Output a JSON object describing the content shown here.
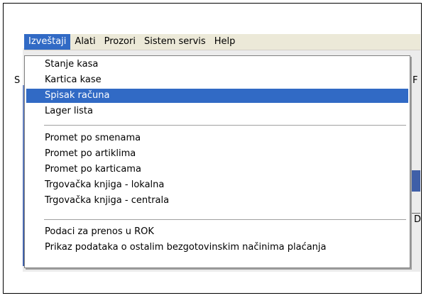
{
  "menubar": {
    "items": [
      {
        "label": "Izveštaji"
      },
      {
        "label": "Alati"
      },
      {
        "label": "Prozori"
      },
      {
        "label": "Sistem servis"
      },
      {
        "label": "Help"
      }
    ]
  },
  "dropdown": {
    "group1": [
      {
        "label": "Stanje kasa"
      },
      {
        "label": "Kartica kase"
      },
      {
        "label": "Spisak računa"
      },
      {
        "label": "Lager lista"
      }
    ],
    "group2": [
      {
        "label": "Promet po smenama"
      },
      {
        "label": "Promet po artiklima"
      },
      {
        "label": "Promet po karticama"
      },
      {
        "label": "Trgovačka knjiga - lokalna"
      },
      {
        "label": "Trgovačka knjiga - centrala"
      }
    ],
    "group3": [
      {
        "label": "Podaci za prenos u ROK"
      },
      {
        "label": "Prikaz podataka o ostalim bezgotovinskim načinima plaćanja"
      }
    ]
  },
  "background": {
    "left_letter": "S",
    "right_letter": "F",
    "right_letter_lower": "D"
  },
  "colors": {
    "highlight": "#316ac5",
    "menubar_bg": "#ece9d8"
  }
}
